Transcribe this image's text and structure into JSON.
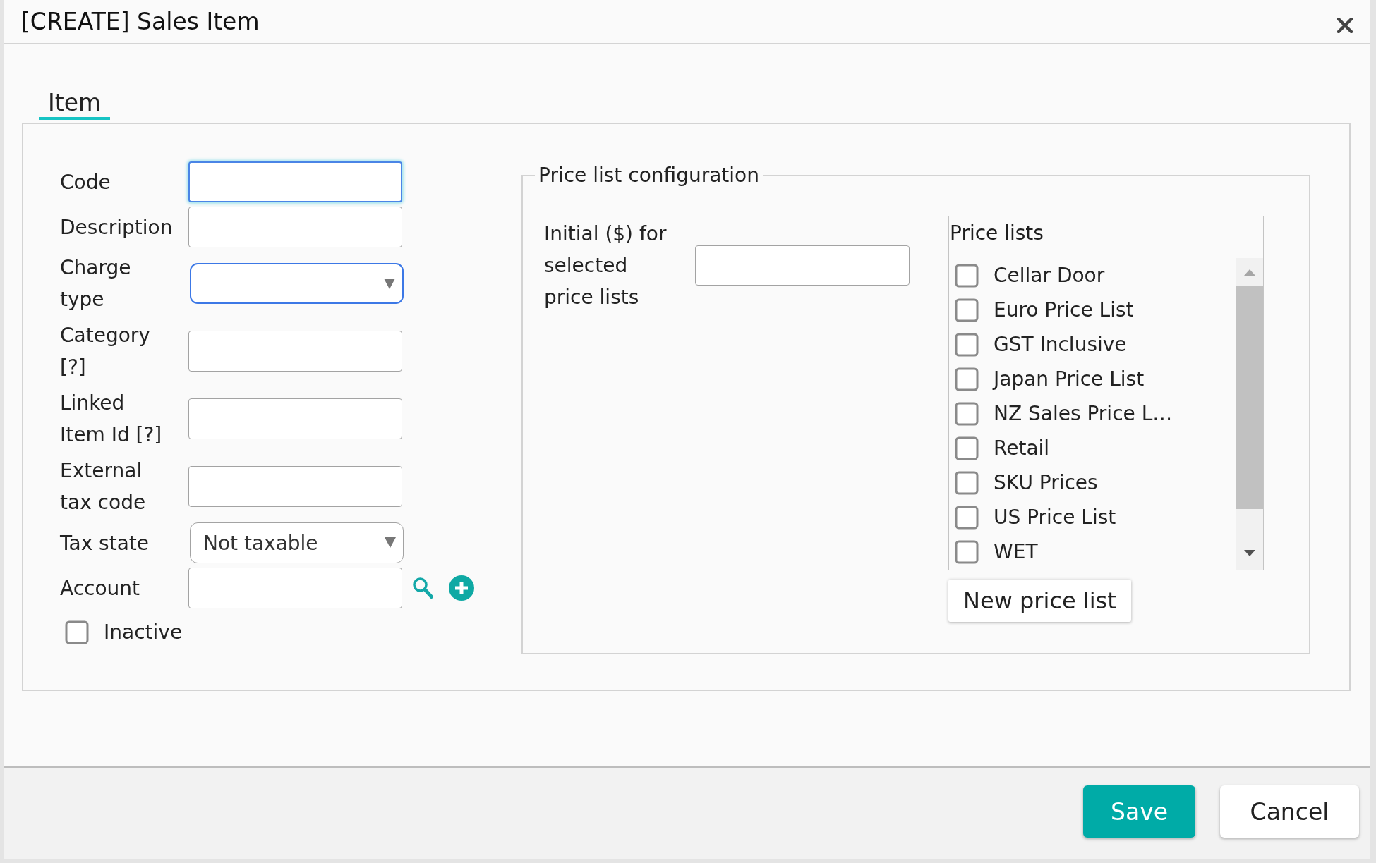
{
  "dialog": {
    "title": "[CREATE] Sales Item"
  },
  "tabs": [
    {
      "label": "Item",
      "selected": true
    }
  ],
  "form": {
    "fields": [
      {
        "label": "Code",
        "kind": "text",
        "focused": true,
        "highlighted": false
      },
      {
        "label": "Description",
        "kind": "text",
        "focused": false,
        "highlighted": false
      },
      {
        "label": "Charge type",
        "kind": "select",
        "focused": false,
        "highlighted": true
      },
      {
        "label": "Category [?]",
        "kind": "text",
        "focused": false,
        "highlighted": false
      },
      {
        "label": "Linked Item Id [?]",
        "kind": "text",
        "focused": false,
        "highlighted": false
      },
      {
        "label": "External tax code",
        "kind": "text",
        "focused": false,
        "highlighted": false
      },
      {
        "label": "Tax state",
        "kind": "select",
        "value": "Not taxable",
        "focused": false,
        "highlighted": false
      },
      {
        "label": "Account",
        "kind": "lookup",
        "focused": false,
        "highlighted": false
      }
    ],
    "inactive": {
      "label": "Inactive",
      "checked": false
    }
  },
  "price_list_configuration": {
    "legend": "Price list configuration",
    "initial_label": "Initial ($) for selected price lists",
    "price_lists": {
      "title": "Price lists",
      "items": [
        {
          "label": "Cellar Door",
          "checked": false
        },
        {
          "label": "Euro Price List",
          "checked": false
        },
        {
          "label": "GST Inclusive",
          "checked": false
        },
        {
          "label": "Japan Price List",
          "checked": false
        },
        {
          "label": "NZ Sales Price L…",
          "checked": false
        },
        {
          "label": "Retail",
          "checked": false
        },
        {
          "label": "SKU Prices",
          "checked": false
        },
        {
          "label": "US Price List",
          "checked": false
        },
        {
          "label": "WET",
          "checked": false
        }
      ]
    },
    "new_button": "New price list"
  },
  "footer": {
    "buttons": [
      {
        "label": "Save",
        "kind": "primary"
      },
      {
        "label": "Cancel",
        "kind": "secondary"
      }
    ]
  }
}
